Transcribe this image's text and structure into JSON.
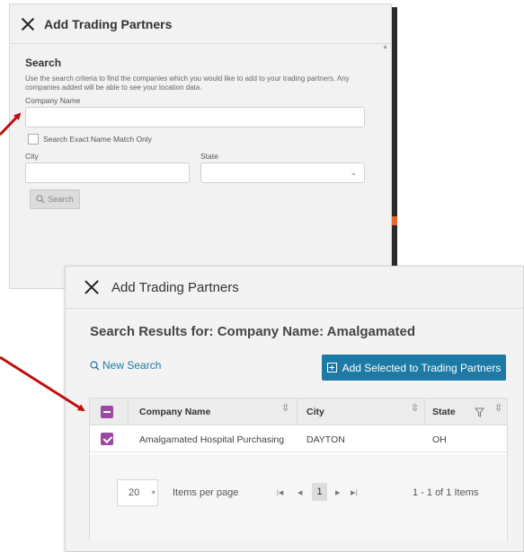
{
  "search_panel": {
    "title": "Add Trading Partners",
    "section_title": "Search",
    "description": "Use the search criteria to find the companies which you would like to add to your trading partners. Any companies added will be able to see your location data.",
    "company_name_label": "Company Name",
    "company_name_value": "",
    "exact_match_label": "Search Exact Name Match Only",
    "city_label": "City",
    "city_value": "",
    "state_label": "State",
    "state_value": "",
    "search_button": "Search"
  },
  "results_panel": {
    "title": "Add Trading Partners",
    "results_heading": "Search Results for: Company Name: Amalgamated",
    "new_search_link": "New Search",
    "add_button": "Add Selected to Trading Partners",
    "columns": [
      "Company Name",
      "City",
      "State"
    ],
    "rows": [
      {
        "company": "Amalgamated Hospital Purchasing",
        "city": "DAYTON",
        "state": "OH",
        "selected": true
      }
    ],
    "pager": {
      "page_size": "20",
      "items_per_page_label": "Items per page",
      "current_page": "1",
      "info": "1 - 1 of 1 Items"
    }
  },
  "colors": {
    "accent": "#1c7aa5",
    "checkbox": "#9a4aa0",
    "arrow": "#c00d0d"
  }
}
